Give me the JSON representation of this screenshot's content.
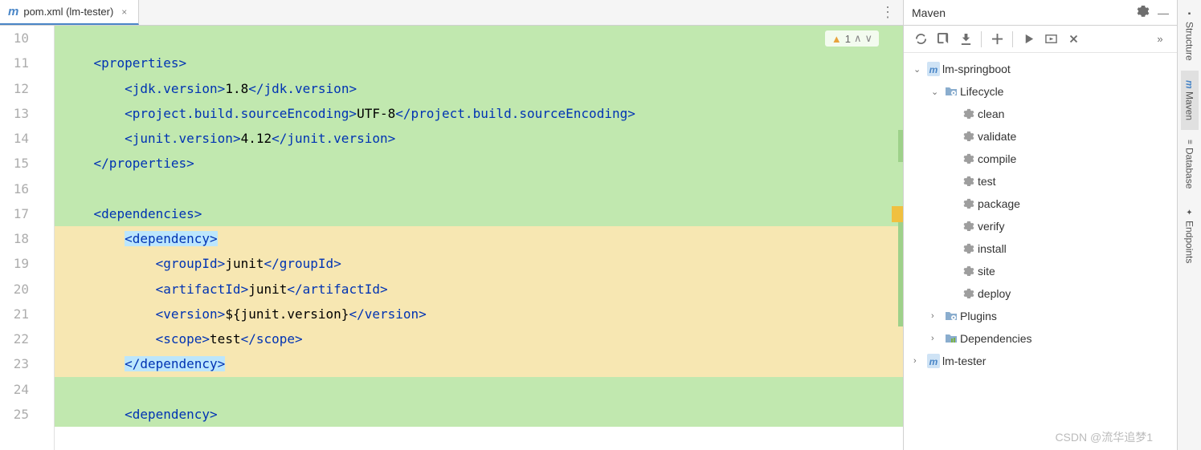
{
  "tab": {
    "title": "pom.xml (lm-tester)"
  },
  "warning": {
    "count": "1"
  },
  "code": {
    "lines": [
      {
        "num": "10",
        "bg": "green",
        "indent": 0,
        "segs": []
      },
      {
        "num": "11",
        "bg": "green",
        "indent": 1,
        "segs": [
          {
            "t": "tag",
            "v": "<"
          },
          {
            "t": "tag",
            "v": "properties"
          },
          {
            "t": "tag",
            "v": ">"
          }
        ]
      },
      {
        "num": "12",
        "bg": "green",
        "indent": 2,
        "segs": [
          {
            "t": "tag",
            "v": "<"
          },
          {
            "t": "tag",
            "v": "jdk.version"
          },
          {
            "t": "tag",
            "v": ">"
          },
          {
            "t": "text",
            "v": "1.8"
          },
          {
            "t": "tag",
            "v": "</"
          },
          {
            "t": "tag",
            "v": "jdk.version"
          },
          {
            "t": "tag",
            "v": ">"
          }
        ]
      },
      {
        "num": "13",
        "bg": "green",
        "indent": 2,
        "segs": [
          {
            "t": "tag",
            "v": "<"
          },
          {
            "t": "tag",
            "v": "project.build.sourceEncoding"
          },
          {
            "t": "tag",
            "v": ">"
          },
          {
            "t": "text",
            "v": "UTF-8"
          },
          {
            "t": "tag",
            "v": "</"
          },
          {
            "t": "tag",
            "v": "project.build.sourceEncoding"
          },
          {
            "t": "tag",
            "v": ">"
          }
        ]
      },
      {
        "num": "14",
        "bg": "green",
        "indent": 2,
        "segs": [
          {
            "t": "tag",
            "v": "<"
          },
          {
            "t": "tag",
            "v": "junit.version"
          },
          {
            "t": "tag",
            "v": ">"
          },
          {
            "t": "text",
            "v": "4.12"
          },
          {
            "t": "tag",
            "v": "</"
          },
          {
            "t": "tag",
            "v": "junit.version"
          },
          {
            "t": "tag",
            "v": ">"
          }
        ]
      },
      {
        "num": "15",
        "bg": "green",
        "indent": 1,
        "segs": [
          {
            "t": "tag",
            "v": "</"
          },
          {
            "t": "tag",
            "v": "properties"
          },
          {
            "t": "tag",
            "v": ">"
          }
        ]
      },
      {
        "num": "16",
        "bg": "green",
        "indent": 0,
        "segs": []
      },
      {
        "num": "17",
        "bg": "green",
        "indent": 1,
        "segs": [
          {
            "t": "tag",
            "v": "<"
          },
          {
            "t": "tag",
            "v": "dependencies"
          },
          {
            "t": "tag",
            "v": ">"
          }
        ]
      },
      {
        "num": "18",
        "bg": "yellow",
        "indent": 2,
        "hl": true,
        "segs": [
          {
            "t": "tag",
            "v": "<"
          },
          {
            "t": "tag",
            "v": "dependency"
          },
          {
            "t": "tag",
            "v": ">"
          }
        ]
      },
      {
        "num": "19",
        "bg": "yellow",
        "indent": 3,
        "segs": [
          {
            "t": "tag",
            "v": "<"
          },
          {
            "t": "tag",
            "v": "groupId"
          },
          {
            "t": "tag",
            "v": ">"
          },
          {
            "t": "text",
            "v": "junit"
          },
          {
            "t": "tag",
            "v": "</"
          },
          {
            "t": "tag",
            "v": "groupId"
          },
          {
            "t": "tag",
            "v": ">"
          }
        ]
      },
      {
        "num": "20",
        "bg": "yellow",
        "indent": 3,
        "segs": [
          {
            "t": "tag",
            "v": "<"
          },
          {
            "t": "tag",
            "v": "artifactId"
          },
          {
            "t": "tag",
            "v": ">"
          },
          {
            "t": "text",
            "v": "junit"
          },
          {
            "t": "tag",
            "v": "</"
          },
          {
            "t": "tag",
            "v": "artifactId"
          },
          {
            "t": "tag",
            "v": ">"
          }
        ]
      },
      {
        "num": "21",
        "bg": "yellow",
        "indent": 3,
        "segs": [
          {
            "t": "tag",
            "v": "<"
          },
          {
            "t": "tag",
            "v": "version"
          },
          {
            "t": "tag",
            "v": ">"
          },
          {
            "t": "text",
            "v": "${junit.version}"
          },
          {
            "t": "tag",
            "v": "</"
          },
          {
            "t": "tag",
            "v": "version"
          },
          {
            "t": "tag",
            "v": ">"
          }
        ]
      },
      {
        "num": "22",
        "bg": "yellow",
        "indent": 3,
        "segs": [
          {
            "t": "tag",
            "v": "<"
          },
          {
            "t": "tag",
            "v": "scope"
          },
          {
            "t": "tag",
            "v": ">"
          },
          {
            "t": "text",
            "v": "test"
          },
          {
            "t": "tag",
            "v": "</"
          },
          {
            "t": "tag",
            "v": "scope"
          },
          {
            "t": "tag",
            "v": ">"
          }
        ]
      },
      {
        "num": "23",
        "bg": "yellow",
        "indent": 2,
        "hl": true,
        "segs": [
          {
            "t": "tag",
            "v": "</"
          },
          {
            "t": "tag",
            "v": "dependency"
          },
          {
            "t": "tag",
            "v": ">"
          }
        ]
      },
      {
        "num": "24",
        "bg": "green",
        "indent": 0,
        "segs": []
      },
      {
        "num": "25",
        "bg": "green",
        "indent": 2,
        "segs": [
          {
            "t": "tag",
            "v": "<"
          },
          {
            "t": "tag",
            "v": "dependency"
          },
          {
            "t": "tag",
            "v": ">"
          }
        ]
      }
    ]
  },
  "maven": {
    "title": "Maven",
    "tree": [
      {
        "indent": 0,
        "chev": "down",
        "icon": "maven",
        "label": "lm-springboot"
      },
      {
        "indent": 1,
        "chev": "down",
        "icon": "folder-gear",
        "label": "Lifecycle"
      },
      {
        "indent": 2,
        "chev": "",
        "icon": "gear",
        "label": "clean"
      },
      {
        "indent": 2,
        "chev": "",
        "icon": "gear",
        "label": "validate"
      },
      {
        "indent": 2,
        "chev": "",
        "icon": "gear",
        "label": "compile"
      },
      {
        "indent": 2,
        "chev": "",
        "icon": "gear",
        "label": "test"
      },
      {
        "indent": 2,
        "chev": "",
        "icon": "gear",
        "label": "package"
      },
      {
        "indent": 2,
        "chev": "",
        "icon": "gear",
        "label": "verify"
      },
      {
        "indent": 2,
        "chev": "",
        "icon": "gear",
        "label": "install"
      },
      {
        "indent": 2,
        "chev": "",
        "icon": "gear",
        "label": "site"
      },
      {
        "indent": 2,
        "chev": "",
        "icon": "gear",
        "label": "deploy"
      },
      {
        "indent": 1,
        "chev": "right",
        "icon": "folder-gear",
        "label": "Plugins"
      },
      {
        "indent": 1,
        "chev": "right",
        "icon": "folder-lib",
        "label": "Dependencies"
      },
      {
        "indent": 0,
        "chev": "right",
        "icon": "maven",
        "label": "lm-tester"
      }
    ]
  },
  "sidebar": {
    "items": [
      "Structure",
      "Maven",
      "Database",
      "Endpoints"
    ]
  },
  "watermark": "CSDN @流华追梦1"
}
